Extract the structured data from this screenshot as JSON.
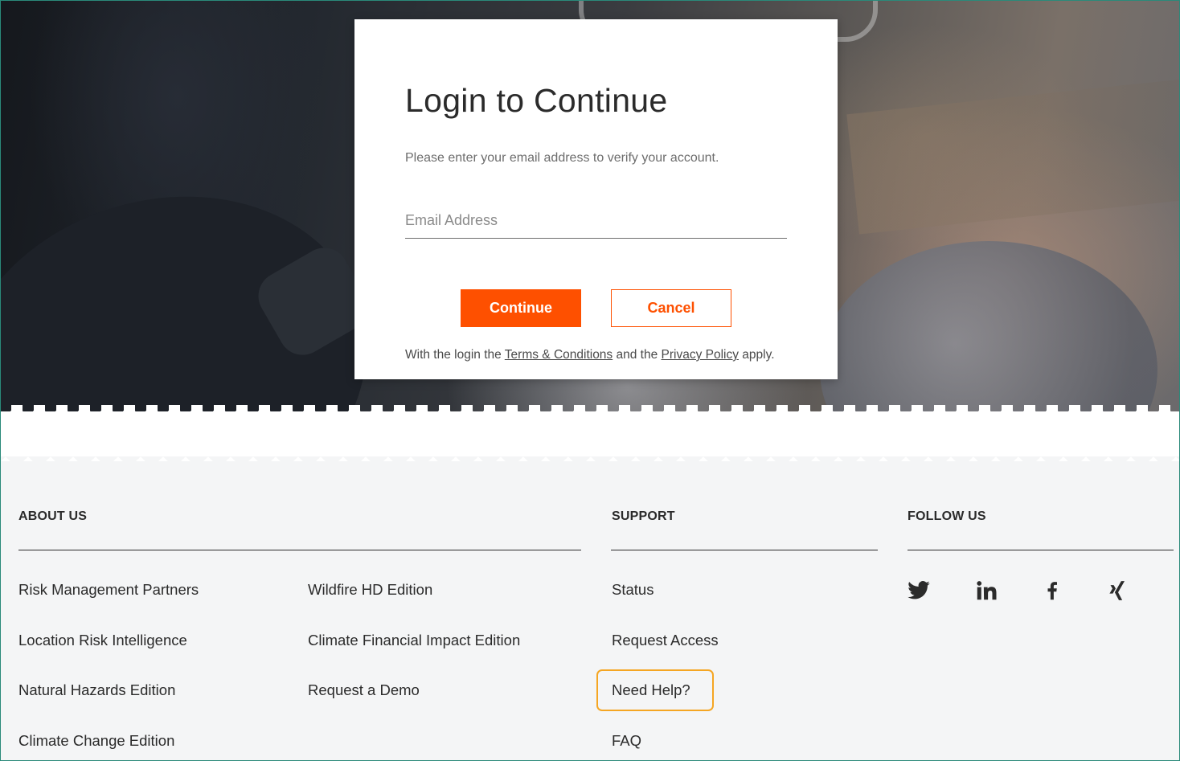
{
  "modal": {
    "title": "Login to Continue",
    "subtitle": "Please enter your email address to verify your account.",
    "email_placeholder": "Email Address",
    "continue_label": "Continue",
    "cancel_label": "Cancel",
    "legal_prefix": "With the login the ",
    "terms_label": "Terms & Conditions",
    "legal_middle": " and the ",
    "privacy_label": "Privacy Policy",
    "legal_suffix": " apply."
  },
  "footer": {
    "about": {
      "heading": "ABOUT US",
      "col1": [
        "Risk Management Partners",
        "Location Risk Intelligence",
        "Natural Hazards Edition",
        "Climate Change Edition"
      ],
      "col2": [
        "Wildfire HD Edition",
        "Climate Financial Impact Edition",
        "Request a Demo"
      ]
    },
    "support": {
      "heading": "SUPPORT",
      "links": [
        "Status",
        "Request Access",
        "Need Help?",
        "FAQ"
      ]
    },
    "follow": {
      "heading": "FOLLOW US",
      "icons": [
        "twitter-icon",
        "linkedin-icon",
        "facebook-icon",
        "xing-icon"
      ]
    }
  },
  "colors": {
    "accent": "#fe5000",
    "focus_ring": "#f5a623",
    "footer_bg": "#f4f5f6",
    "text": "#2b2b2b"
  }
}
